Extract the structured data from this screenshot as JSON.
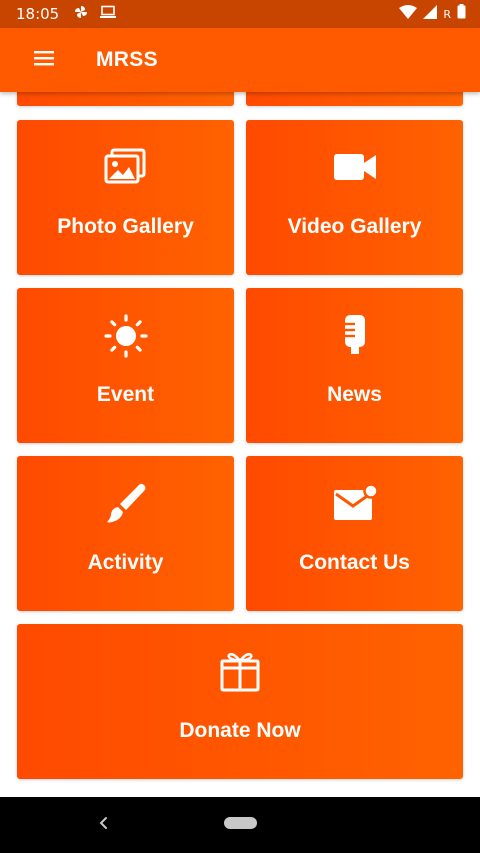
{
  "status_bar": {
    "time": "18:05",
    "carrier_mark": "R",
    "icons": [
      "pinwheel-icon",
      "laptop-icon",
      "wifi-icon",
      "cell-signal-icon",
      "battery-icon"
    ]
  },
  "app_bar": {
    "title": "MRSS",
    "menu_icon": "hamburger-menu-icon"
  },
  "tiles": [
    {
      "label": "Photo Gallery",
      "icon": "photo-gallery-icon"
    },
    {
      "label": "Video Gallery",
      "icon": "video-camera-icon"
    },
    {
      "label": "Event",
      "icon": "sun-icon"
    },
    {
      "label": "News",
      "icon": "microphone-icon"
    },
    {
      "label": "Activity",
      "icon": "brush-icon"
    },
    {
      "label": "Contact Us",
      "icon": "mail-notification-icon"
    },
    {
      "label": "Donate Now",
      "icon": "gift-icon"
    }
  ],
  "colors": {
    "status_bar": "#c84500",
    "app_bar": "#ff5a00",
    "tile_gradient_start": "#ff4a00",
    "tile_gradient_end": "#ff6200",
    "nav_bar": "#000000"
  }
}
